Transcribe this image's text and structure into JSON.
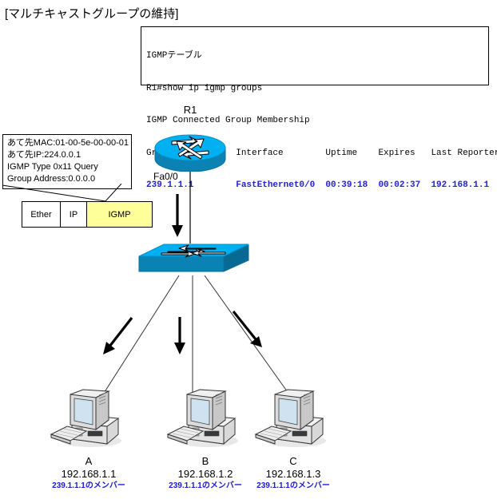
{
  "page": {
    "title": "[マルチキャストグループの維持]"
  },
  "igmp_table": {
    "caption": "IGMPテーブル",
    "command": "R1#show ip igmp groups",
    "subtitle": "IGMP Connected Group Membership",
    "header": "Group Address    Interface        Uptime    Expires   Last Reporter",
    "row": "239.1.1.1        FastEthernet0/0  00:39:18  00:02:37  192.168.1.1",
    "columns": [
      "Group Address",
      "Interface",
      "Uptime",
      "Expires",
      "Last Reporter"
    ],
    "values": [
      "239.1.1.1",
      "FastEthernet0/0",
      "00:39:18",
      "00:02:37",
      "192.168.1.1"
    ],
    "data_color": "#2222cc"
  },
  "query_callout": {
    "line1": "あて先MAC:01-00-5e-00-00-01",
    "line2": "あて先IP:224.0.0.1",
    "line3": "IGMP Type 0x11 Query",
    "line4": "Group Address:0.0.0.0"
  },
  "frame": {
    "cells": [
      {
        "label": "Ether",
        "color": "#ffffff"
      },
      {
        "label": "IP",
        "color": "#ffffff"
      },
      {
        "label": "IGMP",
        "color": "#ffff99"
      }
    ]
  },
  "router": {
    "name": "R1",
    "interface": "Fa0/0",
    "icon": "router-icon",
    "color": "#00a8e8"
  },
  "switch": {
    "icon": "switch-icon",
    "color": "#0099dd"
  },
  "hosts": [
    {
      "name": "A",
      "ip": "192.168.1.1",
      "member": "239.1.1.1のメンバー"
    },
    {
      "name": "B",
      "ip": "192.168.1.2",
      "member": "239.1.1.1のメンバー"
    },
    {
      "name": "C",
      "ip": "192.168.1.3",
      "member": "239.1.1.1のメンバー"
    }
  ],
  "colors": {
    "highlight": "#ffff99",
    "link_text": "#1a1ad0",
    "device": "#00a8e8"
  }
}
